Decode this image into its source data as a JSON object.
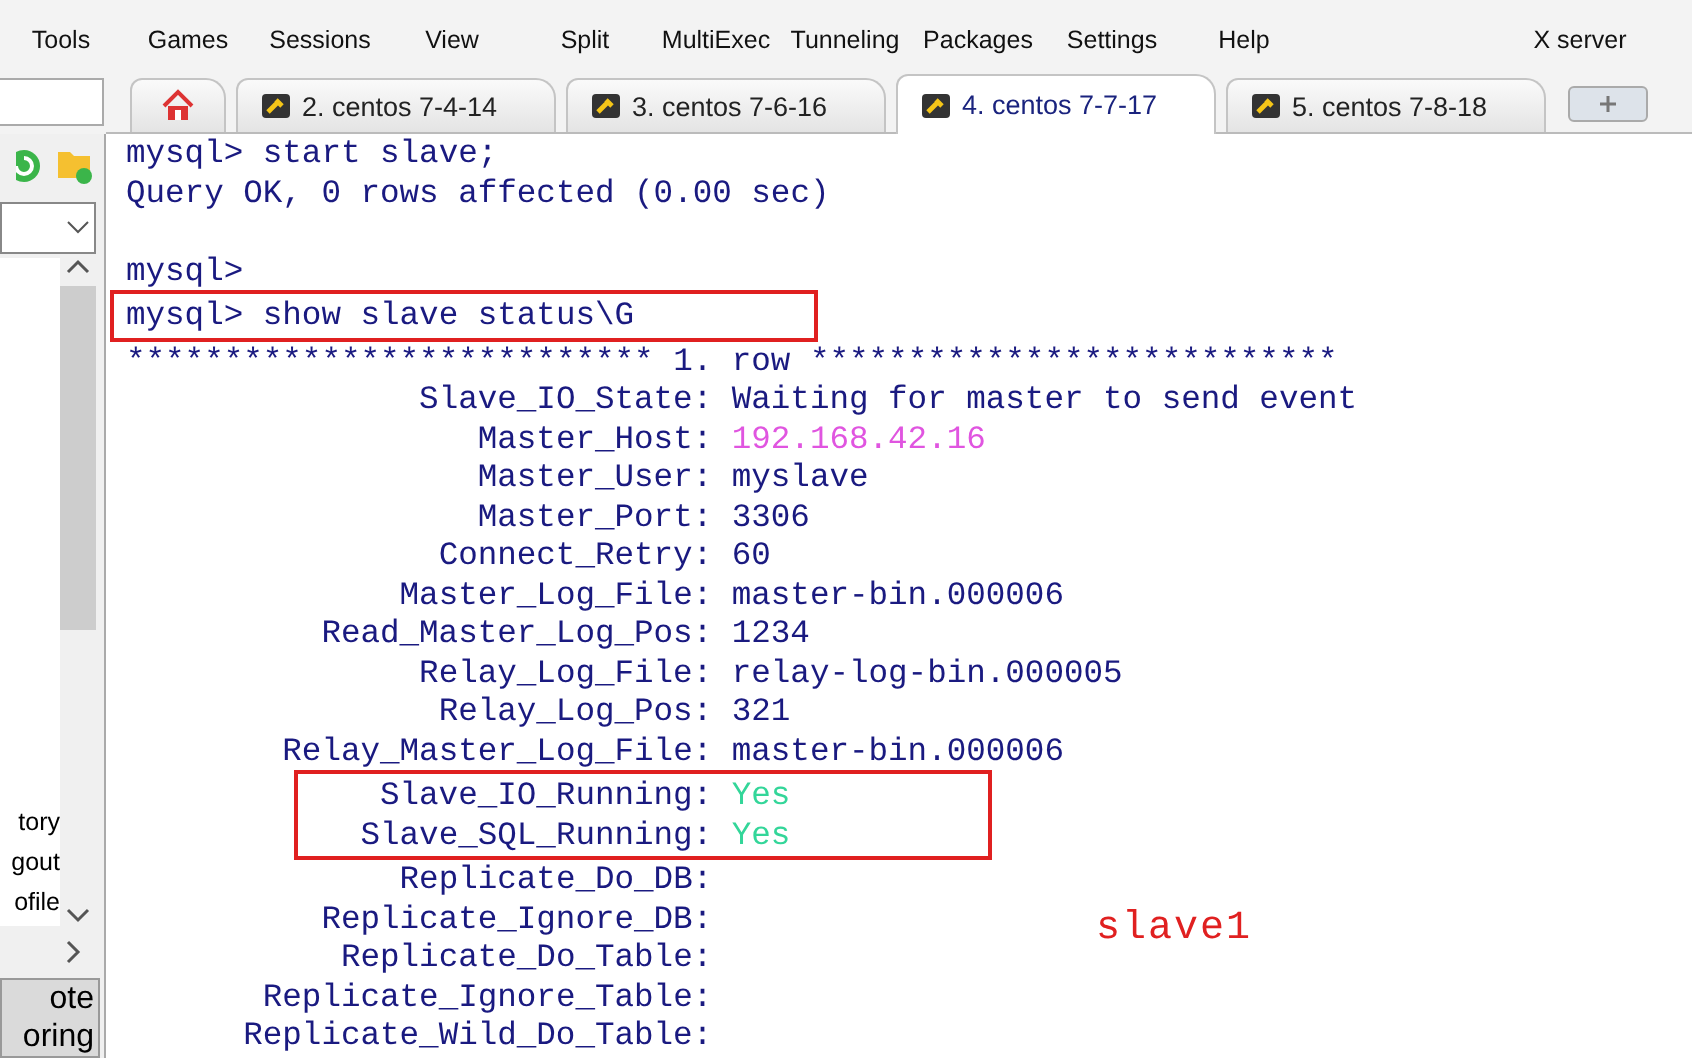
{
  "toolbar": {
    "items": [
      {
        "label": "Tools"
      },
      {
        "label": "Games"
      },
      {
        "label": "Sessions"
      },
      {
        "label": "View"
      },
      {
        "label": "Split"
      },
      {
        "label": "MultiExec"
      },
      {
        "label": "Tunneling"
      },
      {
        "label": "Packages"
      },
      {
        "label": "Settings"
      },
      {
        "label": "Help"
      },
      {
        "label": "X server"
      }
    ]
  },
  "tabs": [
    {
      "kind": "home",
      "selected": false
    },
    {
      "kind": "session",
      "label": "2. centos 7-4-14",
      "selected": false
    },
    {
      "kind": "session",
      "label": "3. centos 7-6-16",
      "selected": false
    },
    {
      "kind": "session",
      "label": "4. centos 7-7-17",
      "selected": true
    },
    {
      "kind": "session",
      "label": "5. centos 7-8-18",
      "selected": false
    }
  ],
  "sidebar": {
    "items": [
      "tory",
      "gout",
      "ofile"
    ],
    "button": [
      "ote",
      "oring"
    ]
  },
  "terminal": {
    "lines": [
      {
        "kind": "text",
        "text": "mysql> start slave;",
        "highlighted": false
      },
      {
        "kind": "text",
        "text": "Query OK, 0 rows affected (0.00 sec)",
        "highlighted": false
      },
      {
        "kind": "blank",
        "highlighted": false
      },
      {
        "kind": "text",
        "text": "mysql>",
        "highlighted": false
      },
      {
        "kind": "text",
        "text": "mysql> show slave status\\G",
        "highlighted": true
      },
      {
        "kind": "text",
        "text": "*************************** 1. row ***************************",
        "highlighted": false
      },
      {
        "kind": "field",
        "key": "Slave_IO_State:",
        "value": "Waiting for master to send event",
        "highlighted": false
      },
      {
        "kind": "field",
        "key": "Master_Host:",
        "value": "192.168.42.16",
        "color": "#e055e0",
        "highlighted": false
      },
      {
        "kind": "field",
        "key": "Master_User:",
        "value": "myslave",
        "highlighted": false
      },
      {
        "kind": "field",
        "key": "Master_Port:",
        "value": "3306",
        "highlighted": false
      },
      {
        "kind": "field",
        "key": "Connect_Retry:",
        "value": "60",
        "highlighted": false
      },
      {
        "kind": "field",
        "key": "Master_Log_File:",
        "value": "master-bin.000006",
        "highlighted": false
      },
      {
        "kind": "field",
        "key": "Read_Master_Log_Pos:",
        "value": "1234",
        "highlighted": false
      },
      {
        "kind": "field",
        "key": "Relay_Log_File:",
        "value": "relay-log-bin.000005",
        "highlighted": false
      },
      {
        "kind": "field",
        "key": "Relay_Log_Pos:",
        "value": "321",
        "highlighted": false
      },
      {
        "kind": "field",
        "key": "Relay_Master_Log_File:",
        "value": "master-bin.000006",
        "highlighted": false
      },
      {
        "kind": "field",
        "key": "Slave_IO_Running:",
        "value": "Yes",
        "color": "#33d699",
        "highlighted": true
      },
      {
        "kind": "field",
        "key": "Slave_SQL_Running:",
        "value": "Yes",
        "color": "#33d699",
        "highlighted": true
      },
      {
        "kind": "field",
        "key": "Replicate_Do_DB:",
        "highlighted": false
      },
      {
        "kind": "field",
        "key": "Replicate_Ignore_DB:",
        "highlighted": false
      },
      {
        "kind": "field",
        "key": "Replicate_Do_Table:",
        "highlighted": false
      },
      {
        "kind": "field",
        "key": "Replicate_Ignore_Table:",
        "highlighted": false
      },
      {
        "kind": "field",
        "key": "Replicate_Wild_Do_Table:",
        "highlighted": false
      }
    ],
    "annotation": "slave1"
  }
}
